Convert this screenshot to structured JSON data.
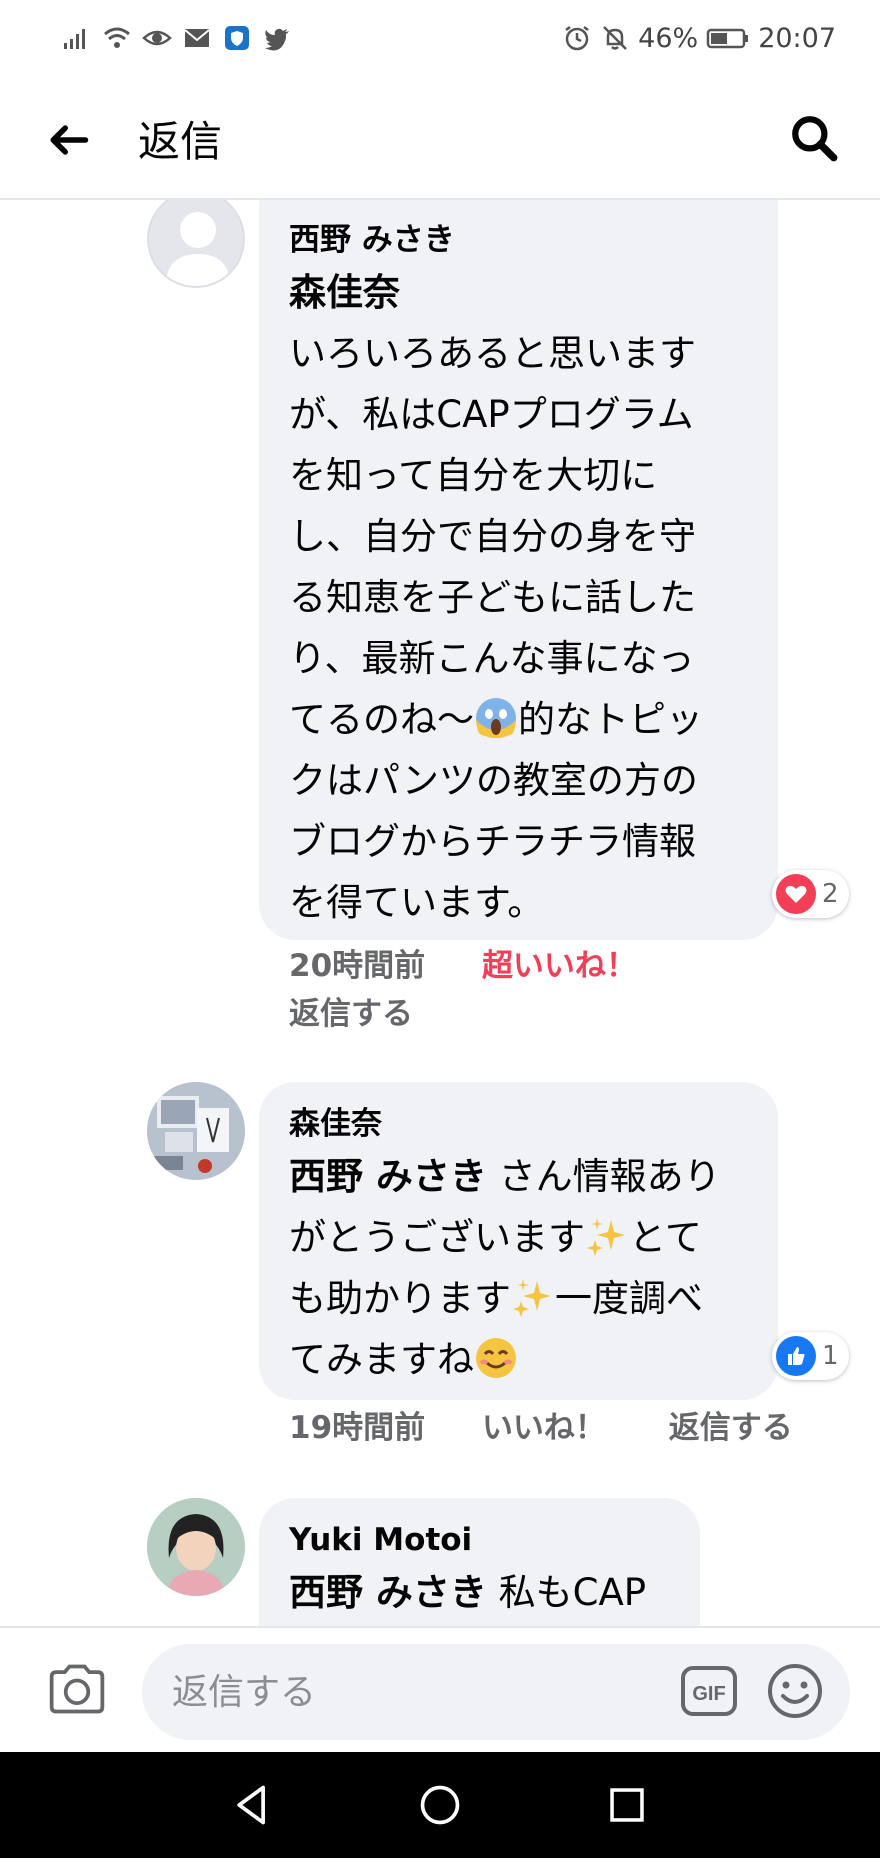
{
  "status_bar": {
    "battery": "46%",
    "time": "20:07"
  },
  "header": {
    "title": "返信"
  },
  "comments": [
    {
      "parent_author": "西野 みさき",
      "mention": "森佳奈",
      "text_lines": [
        "いろいろあると思います",
        "が、私はCAPプログラム",
        "を知って自分を大切に",
        "し、自分で自分の身を守",
        "る知恵を子どもに話した",
        "り、最新こんな事になっ",
        "てるのね〜",
        "クはパンツの教室の方の",
        "ブログからチラチラ情報",
        "を得ています。"
      ],
      "line7_after_emoji": "的なトピッ",
      "reaction_count": "2",
      "time": "20時間前",
      "reaction_label": "超いいね！",
      "reply_label": "返信する"
    },
    {
      "author": "森佳奈",
      "mention": "西野 みさき",
      "line1_rest": " さん情報あり",
      "line2a": "がとうございます",
      "line2b": "とて",
      "line3a": "も助かります",
      "line3b": "一度調べ",
      "line4": "てみますね",
      "reaction_count": "1",
      "time": "19時間前",
      "like_label": "いいね！",
      "reply_label": "返信する"
    },
    {
      "author": "Yuki Motoi",
      "mention": "西野 みさき",
      "text": " 私もCAP"
    }
  ],
  "composer": {
    "placeholder": "返信する",
    "gif_label": "GIF"
  },
  "colors": {
    "bubble": "#f0f2f5",
    "love_red": "#f33e58",
    "like_blue": "#1877f2",
    "super_like_text": "#f33e58"
  }
}
